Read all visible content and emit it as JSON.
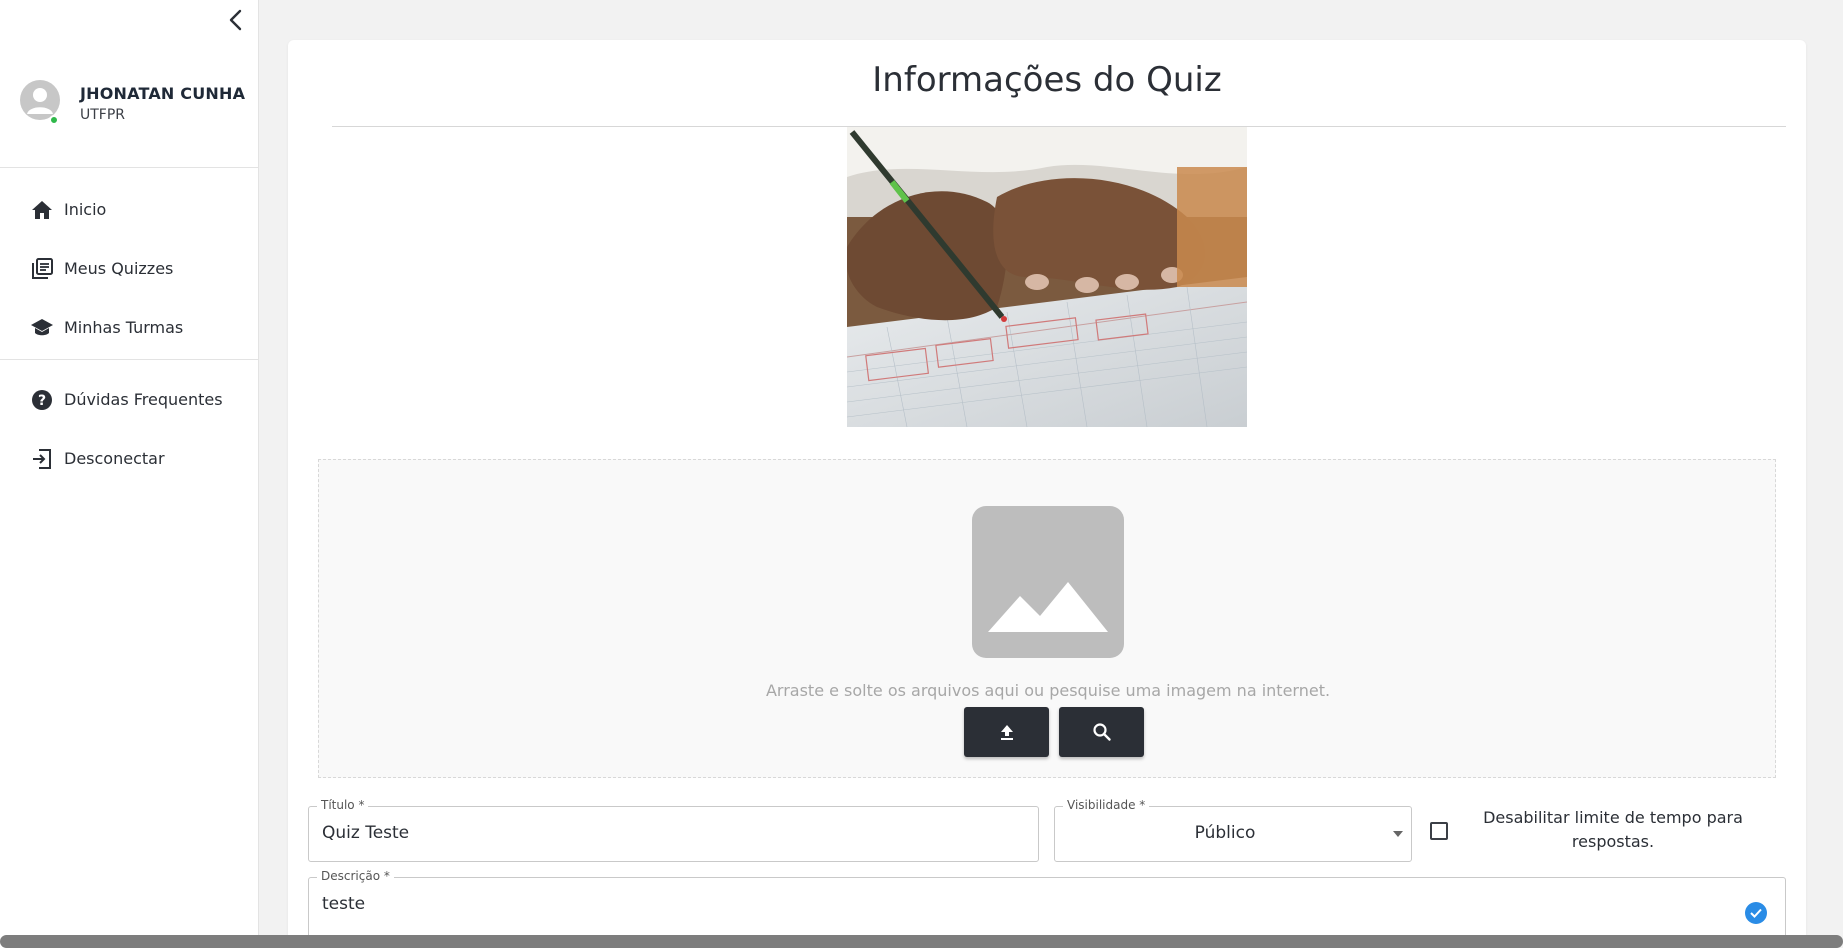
{
  "sidebar": {
    "collapse_icon": "chevron-left-icon",
    "profile": {
      "name": "JHONATAN CUNHA",
      "org": "UTFPR",
      "status_color": "#2fb84a"
    },
    "items": [
      {
        "label": "Inicio",
        "icon": "home-icon"
      },
      {
        "label": "Meus Quizzes",
        "icon": "library-icon"
      },
      {
        "label": "Minhas Turmas",
        "icon": "school-icon"
      },
      {
        "label": "Dúvidas Frequentes",
        "icon": "help-circle-icon"
      },
      {
        "label": "Desconectar",
        "icon": "logout-icon"
      }
    ]
  },
  "main": {
    "title": "Informações do Quiz",
    "dropzone": {
      "text": "Arraste e solte os arquivos aqui ou pesquise uma imagem na internet.",
      "upload_icon": "upload-icon",
      "search_icon": "search-icon"
    },
    "form": {
      "title_label": "Título *",
      "title_value": "Quiz Teste",
      "visibility_label": "Visibilidade *",
      "visibility_value": "Público",
      "time_limit_label": "Desabilitar limite de tempo para respostas.",
      "time_limit_checked": false,
      "description_label": "Descrição *",
      "description_value": "teste"
    }
  },
  "colors": {
    "accent_dark": "#2b2f36",
    "valid_blue": "#2a8ce6",
    "background": "#f2f2f2"
  }
}
